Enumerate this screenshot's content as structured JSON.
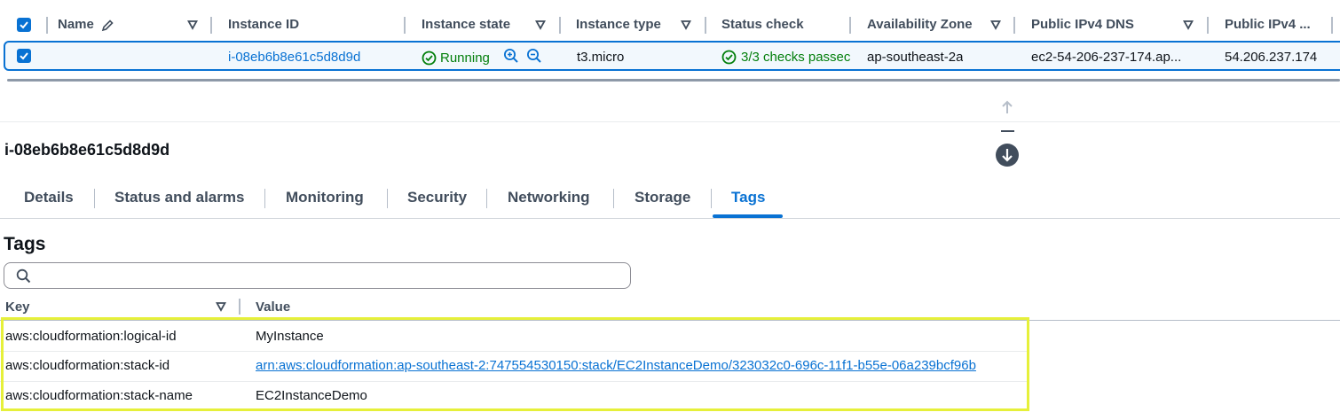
{
  "instances_table": {
    "columns": [
      "Name",
      "Instance ID",
      "Instance state",
      "Instance type",
      "Status check",
      "Availability Zone",
      "Public IPv4 DNS",
      "Public IPv4 ..."
    ],
    "row": {
      "name": "",
      "instance_id": "i-08eb6b8e61c5d8d9d",
      "instance_state": "Running",
      "instance_type": "t3.micro",
      "status_check": "3/3 checks passec",
      "availability_zone": "ap-southeast-2a",
      "public_dns": "ec2-54-206-237-174.ap...",
      "public_ip": "54.206.237.174"
    }
  },
  "details": {
    "title": "i-08eb6b8e61c5d8d9d",
    "tabs": [
      "Details",
      "Status and alarms",
      "Monitoring",
      "Security",
      "Networking",
      "Storage",
      "Tags"
    ],
    "active_tab": "Tags"
  },
  "tags": {
    "title": "Tags",
    "search_placeholder": "",
    "columns": [
      "Key",
      "Value"
    ],
    "rows": [
      {
        "key": "aws:cloudformation:logical-id",
        "value": "MyInstance"
      },
      {
        "key": "aws:cloudformation:stack-id",
        "value": "arn:aws:cloudformation:ap-southeast-2:747554530150:stack/EC2InstanceDemo/323032c0-696c-11f1-b55e-06a239bcf96b"
      },
      {
        "key": "aws:cloudformation:stack-name",
        "value": "EC2InstanceDemo"
      }
    ]
  },
  "colors": {
    "accent": "#0972d3",
    "success": "#037f0c",
    "highlight": "#e6f03a"
  }
}
